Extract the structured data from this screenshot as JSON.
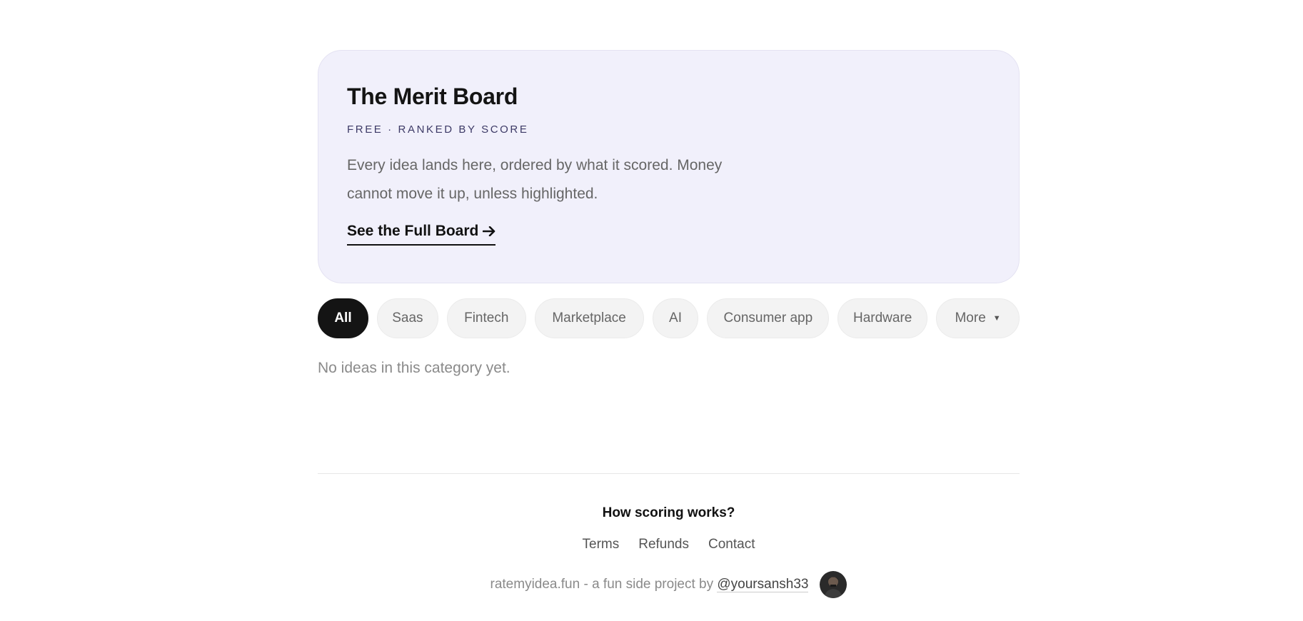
{
  "merit_board": {
    "title": "The Merit Board",
    "subtitle": "FREE · RANKED BY SCORE",
    "description": "Every idea lands here, ordered by what it scored. Money cannot move it up, unless highlighted.",
    "link_label": "See the Full Board",
    "link_icon": "arrow-right-icon"
  },
  "categories": {
    "tabs": [
      {
        "label": "All",
        "active": true
      },
      {
        "label": "Saas"
      },
      {
        "label": "Fintech"
      },
      {
        "label": "Marketplace"
      },
      {
        "label": "AI"
      },
      {
        "label": "Consumer app"
      },
      {
        "label": "Hardware"
      },
      {
        "label": "More",
        "icon": "caret-down-icon"
      }
    ]
  },
  "ideas": {
    "empty_message": "No ideas in this category yet."
  },
  "footer": {
    "heading": "How scoring works?",
    "links": [
      "Terms",
      "Refunds",
      "Contact"
    ],
    "credit_text": "ratemyidea.fun - a fun side project by",
    "credit_handle": "@yoursansh33",
    "avatar_icon": "avatar-photo"
  },
  "colors": {
    "card_background": "#f1f0fb",
    "active_tab": "#141414",
    "tab_background": "#f3f3f3",
    "subtitle": "#3d3a66"
  }
}
